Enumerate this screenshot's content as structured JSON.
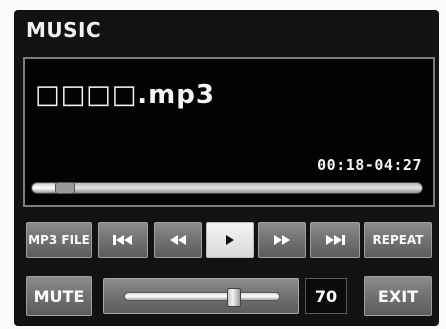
{
  "app": {
    "title": "MUSIC"
  },
  "player": {
    "filename": "□□□□.mp3",
    "time_display": "00:18-04:27",
    "progress_fraction": 0.07
  },
  "controls": {
    "mp3_file_label": "MP3 FILE",
    "repeat_label": "REPEAT",
    "prev_icon": "skip-previous-icon",
    "rewind_icon": "rewind-icon",
    "play_icon": "play-icon",
    "forward_icon": "fast-forward-icon",
    "next_icon": "skip-next-icon"
  },
  "footer": {
    "mute_label": "MUTE",
    "volume": "70",
    "volume_fraction": 0.7,
    "exit_label": "EXIT"
  }
}
